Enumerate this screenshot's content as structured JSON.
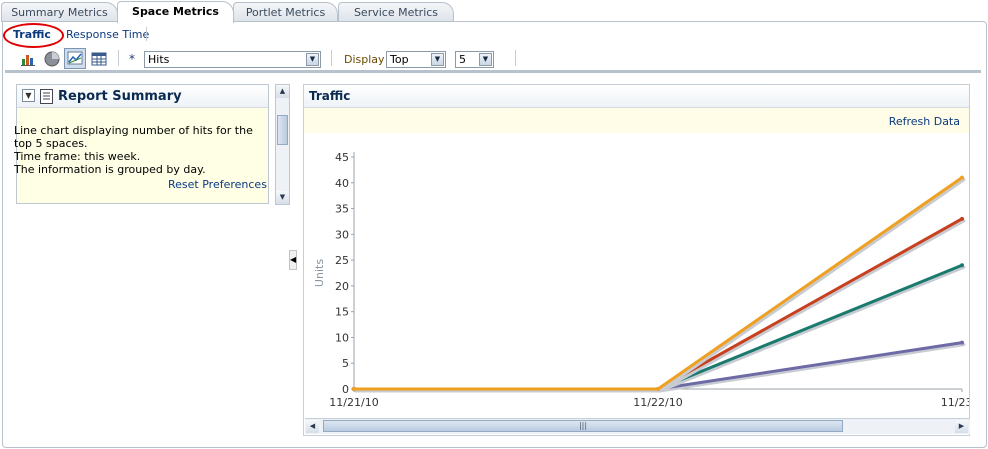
{
  "tabs": [
    {
      "label": "Summary Metrics",
      "active": false
    },
    {
      "label": "Space Metrics",
      "active": true
    },
    {
      "label": "Portlet Metrics",
      "active": false
    },
    {
      "label": "Service Metrics",
      "active": false
    }
  ],
  "subtabs": {
    "traffic": "Traffic",
    "response_time": "Response Time"
  },
  "toolbar": {
    "icons": [
      "bar-chart-icon",
      "pie-chart-icon",
      "line-chart-icon",
      "table-icon"
    ],
    "required_marker": "*",
    "metric_value": "Hits",
    "display_label": "Display",
    "display_value": "Top",
    "count_value": "5"
  },
  "report_summary": {
    "title": "Report Summary",
    "lines": [
      "Line chart displaying number of hits for the",
      "top 5 spaces.",
      "Time frame: this week.",
      "The information is grouped by day."
    ],
    "reset_link": "Reset Preferences"
  },
  "chart_panel": {
    "title": "Traffic",
    "refresh_link": "Refresh Data"
  },
  "chart_data": {
    "type": "line",
    "x": [
      "11/21/10",
      "11/22/10",
      "11/23/1"
    ],
    "ylabel": "Units",
    "xlabel": "",
    "ylim": [
      0,
      45
    ],
    "yticks": [
      0,
      5,
      10,
      15,
      20,
      25,
      30,
      35,
      40,
      45
    ],
    "grid": false,
    "series": [
      {
        "color": "#f0a020",
        "values": [
          0,
          0,
          41
        ]
      },
      {
        "color": "#c8401e",
        "values": [
          0,
          0,
          33
        ]
      },
      {
        "color": "#1b7a6e",
        "values": [
          0,
          0,
          24
        ]
      },
      {
        "color": "#6e6aa6",
        "values": [
          0,
          0,
          9
        ]
      }
    ]
  },
  "colors": {
    "accent": "#0b3a80",
    "highlight_oval": "#e00000"
  }
}
